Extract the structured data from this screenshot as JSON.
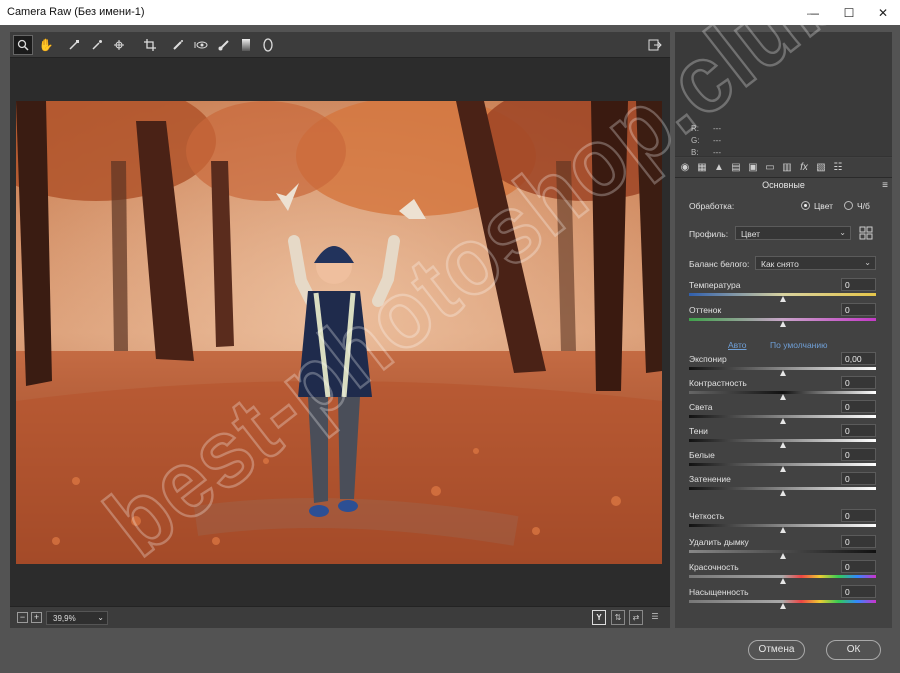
{
  "window": {
    "title": "Camera Raw (Без имени-1)"
  },
  "toolbar": {
    "tools": [
      "zoom-tool",
      "hand-tool",
      "white-balance-tool",
      "color-sampler-tool",
      "targeted-adjustment-tool",
      "crop-tool",
      "spot-removal-tool",
      "red-eye-tool",
      "adjustment-brush-tool",
      "graduated-filter-tool",
      "radial-filter-tool",
      "open-preferences-icon"
    ]
  },
  "zoom": {
    "value": "39,9%",
    "minus": "−",
    "plus": "+"
  },
  "histogram": {
    "r": "R:",
    "g": "G:",
    "b": "B:",
    "r_val": "---",
    "g_val": "---",
    "b_val": "---"
  },
  "panel": {
    "title": "Основные",
    "processing_label": "Обработка:",
    "processing_options": [
      "Цвет",
      "Ч/б"
    ],
    "processing_selected": "Цвет",
    "profile_label": "Профиль:",
    "profile_value": "Цвет",
    "wb_label": "Баланс белого:",
    "wb_value": "Как снято",
    "auto_link": "Авто",
    "default_link": "По умолчанию",
    "sliders": [
      {
        "label": "Температура",
        "value": "0"
      },
      {
        "label": "Оттенок",
        "value": "0"
      },
      {
        "label": "Экспонир",
        "value": "0,00"
      },
      {
        "label": "Контрастность",
        "value": "0"
      },
      {
        "label": "Света",
        "value": "0"
      },
      {
        "label": "Тени",
        "value": "0"
      },
      {
        "label": "Белые",
        "value": "0"
      },
      {
        "label": "Затенение",
        "value": "0"
      },
      {
        "label": "Четкость",
        "value": "0"
      },
      {
        "label": "Удалить дымку",
        "value": "0"
      },
      {
        "label": "Красочность",
        "value": "0"
      },
      {
        "label": "Насыщенность",
        "value": "0"
      }
    ]
  },
  "buttons": {
    "cancel": "Отмена",
    "ok": "ОК"
  },
  "colors": {
    "accent_link": "#6f9fd6",
    "panel_bg": "#424242",
    "app_bg": "#535353"
  },
  "watermark": "best-photoshop.club"
}
